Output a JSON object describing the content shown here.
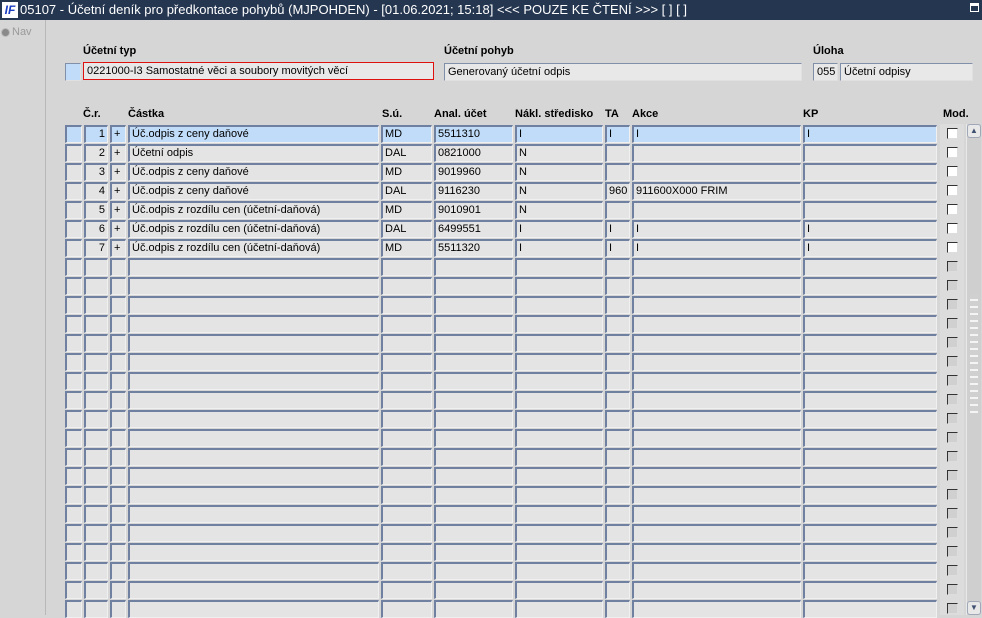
{
  "window": {
    "title": "05107 - Účetní deník pro předkontace pohybů (MJPOHDEN) - [01.06.2021; 15:18] <<< POUZE KE ČTENÍ >>> [ ] [ ]",
    "logo": "IF"
  },
  "nav": {
    "label": "Nav"
  },
  "header": {
    "ucetni_typ_label": "Účetní typ",
    "ucetni_typ_value": "0221000-I3 Samostatné věci a soubory movitých věcí",
    "ucetni_pohyb_label": "Účetní pohyb",
    "ucetni_pohyb_value": "Generovaný účetní odpis",
    "uloha_label": "Úloha",
    "uloha_code": "055",
    "uloha_name": "Účetní odpisy"
  },
  "table": {
    "columns": {
      "cr": "Č.r.",
      "castka": "Částka",
      "su": "S.ú.",
      "anal": "Anal. účet",
      "nakl": "Nákl. středisko",
      "ta": "TA",
      "akce": "Akce",
      "kp": "KP",
      "mod": "Mod."
    },
    "rows": [
      {
        "cr": "1",
        "sign": "+",
        "castka": "Úč.odpis z ceny daňové",
        "su": "MD",
        "anal": "5511310",
        "nakl": "I",
        "ta": "I",
        "akce": "I",
        "kp": "I"
      },
      {
        "cr": "2",
        "sign": "+",
        "castka": "Účetní odpis",
        "su": "DAL",
        "anal": "0821000",
        "nakl": "N",
        "ta": "",
        "akce": "",
        "kp": ""
      },
      {
        "cr": "3",
        "sign": "+",
        "castka": "Úč.odpis z ceny daňové",
        "su": "MD",
        "anal": "9019960",
        "nakl": "N",
        "ta": "",
        "akce": "",
        "kp": ""
      },
      {
        "cr": "4",
        "sign": "+",
        "castka": "Úč.odpis z ceny daňové",
        "su": "DAL",
        "anal": "9116230",
        "nakl": "N",
        "ta": "960",
        "akce": "911600X000 FRIM",
        "kp": ""
      },
      {
        "cr": "5",
        "sign": "+",
        "castka": "Úč.odpis z rozdílu cen (účetní-daňová)",
        "su": "MD",
        "anal": "9010901",
        "nakl": "N",
        "ta": "",
        "akce": "",
        "kp": ""
      },
      {
        "cr": "6",
        "sign": "+",
        "castka": "Úč.odpis z rozdílu cen (účetní-daňová)",
        "su": "DAL",
        "anal": "6499551",
        "nakl": "I",
        "ta": "I",
        "akce": "I",
        "kp": "I"
      },
      {
        "cr": "7",
        "sign": "+",
        "castka": "Úč.odpis z rozdílu cen (účetní-daňová)",
        "su": "MD",
        "anal": "5511320",
        "nakl": "I",
        "ta": "I",
        "akce": "I",
        "kp": "I"
      }
    ]
  }
}
